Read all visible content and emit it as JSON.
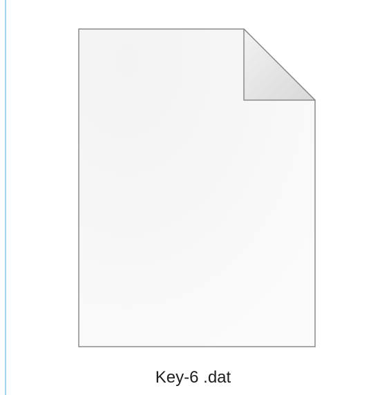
{
  "explorer": {
    "file": {
      "name": "Key-6 .dat",
      "icon": "blank-document-icon"
    }
  }
}
